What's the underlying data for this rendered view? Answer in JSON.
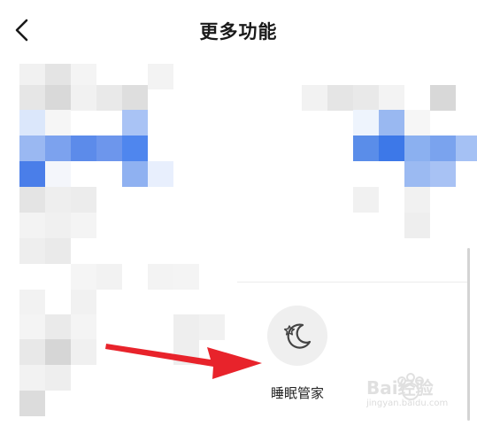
{
  "header": {
    "back_icon": "chevron-left-icon",
    "title": "更多功能"
  },
  "feature": {
    "label": "睡眠管家",
    "icon": "moon-star-icon"
  },
  "colors": {
    "accent_blue": "#4f86ee",
    "arrow_red": "#e8232b",
    "icon_circle": "#efefef"
  },
  "watermark": {
    "title": "Bai经验",
    "subtitle": "jingyan.baidu.com"
  }
}
